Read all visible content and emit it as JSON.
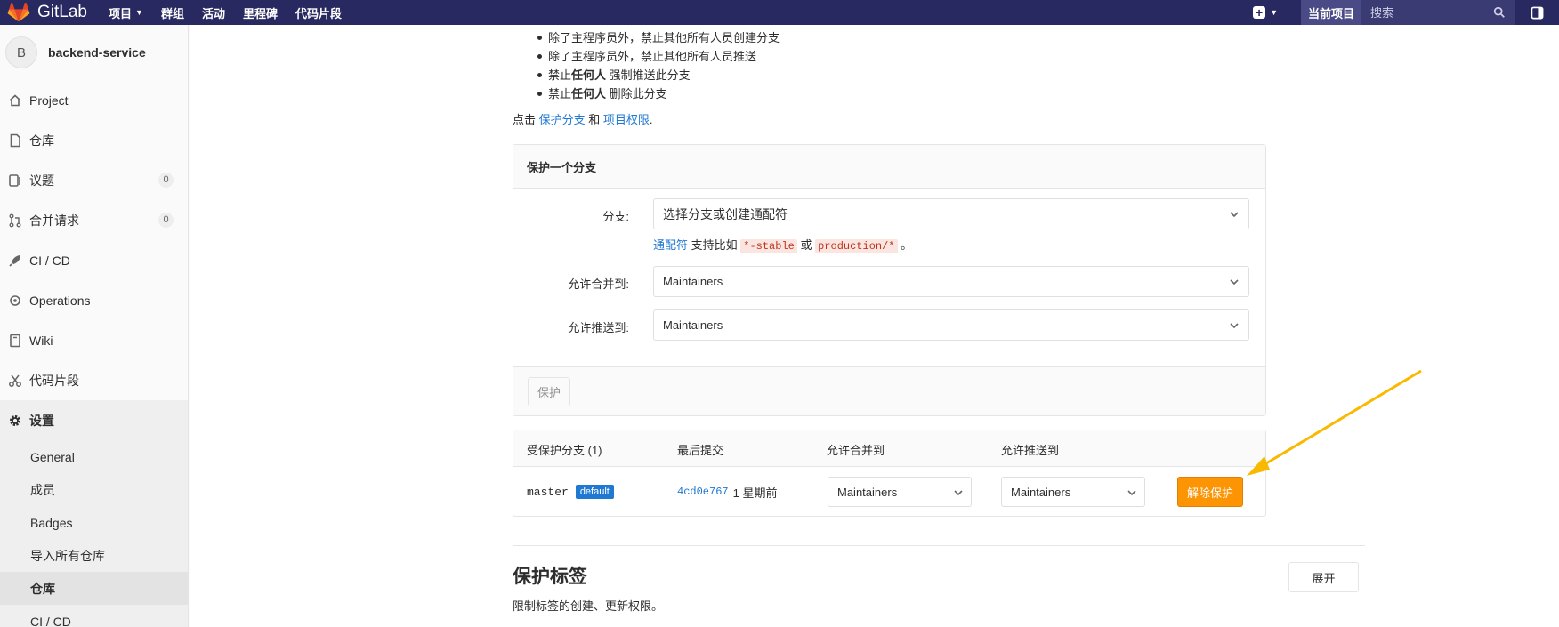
{
  "colors": {
    "nav_bg": "#292961",
    "link": "#1f78d1",
    "warning": "#fc9403",
    "badge": "#1f78d1",
    "arrow": "#f9b900"
  },
  "topnav": {
    "brand": "GitLab",
    "links": [
      {
        "label": "项目",
        "has_caret": true
      },
      {
        "label": "群组"
      },
      {
        "label": "活动"
      },
      {
        "label": "里程碑"
      },
      {
        "label": "代码片段"
      }
    ],
    "search_scope": "当前项目",
    "search_placeholder": "搜索"
  },
  "sidebar": {
    "avatar_letter": "B",
    "project_name": "backend-service",
    "items": [
      {
        "label": "Project",
        "icon": "home-icon"
      },
      {
        "label": "仓库",
        "icon": "doc-icon"
      },
      {
        "label": "议题",
        "icon": "issues-icon",
        "badge": "0"
      },
      {
        "label": "合并请求",
        "icon": "merge-request-icon",
        "badge": "0"
      },
      {
        "label": "CI / CD",
        "icon": "rocket-icon"
      },
      {
        "label": "Operations",
        "icon": "cloud-gear-icon"
      },
      {
        "label": "Wiki",
        "icon": "book-icon"
      },
      {
        "label": "代码片段",
        "icon": "scissors-icon"
      },
      {
        "label": "设置",
        "icon": "gear-icon",
        "active": true
      }
    ],
    "sub_items": [
      {
        "label": "General"
      },
      {
        "label": "成员"
      },
      {
        "label": "Badges"
      },
      {
        "label": "导入所有仓库"
      },
      {
        "label": "仓库",
        "active": true
      },
      {
        "label": "CI / CD"
      }
    ]
  },
  "rules": [
    {
      "text": "除了主程序员外，禁止其他所有人员创建分支"
    },
    {
      "text": "除了主程序员外，禁止其他所有人员推送"
    },
    {
      "pre": "禁止",
      "bold": "任何人",
      "post": " 强制推送此分支"
    },
    {
      "pre": "禁止",
      "bold": "任何人",
      "post": " 删除此分支"
    }
  ],
  "click_line": {
    "pre": "点击 ",
    "link1": "保护分支",
    "mid": " 和 ",
    "link2": "项目权限",
    "post": "."
  },
  "protect_form": {
    "title": "保护一个分支",
    "branch_label": "分支:",
    "branch_placeholder": "选择分支或创建通配符",
    "hint_link": "通配符",
    "hint_text": " 支持比如 ",
    "hint_code1": "*-stable",
    "hint_or": " 或 ",
    "hint_code2": "production/*",
    "hint_end": " 。",
    "merge_label": "允许合并到:",
    "merge_value": "Maintainers",
    "push_label": "允许推送到:",
    "push_value": "Maintainers",
    "protect_button": "保护"
  },
  "protected_table": {
    "headers": {
      "branch": "受保护分支 (1)",
      "last_commit": "最后提交",
      "merge": "允许合并到",
      "push": "允许推送到"
    },
    "rows": [
      {
        "branch": "master",
        "badge": "default",
        "sha": "4cd0e767",
        "time": "1 星期前",
        "merge": "Maintainers",
        "push": "Maintainers",
        "action": "解除保护"
      }
    ]
  },
  "tags_section": {
    "title": "保护标签",
    "description": "限制标签的创建、更新权限。",
    "expand_button": "展开"
  }
}
